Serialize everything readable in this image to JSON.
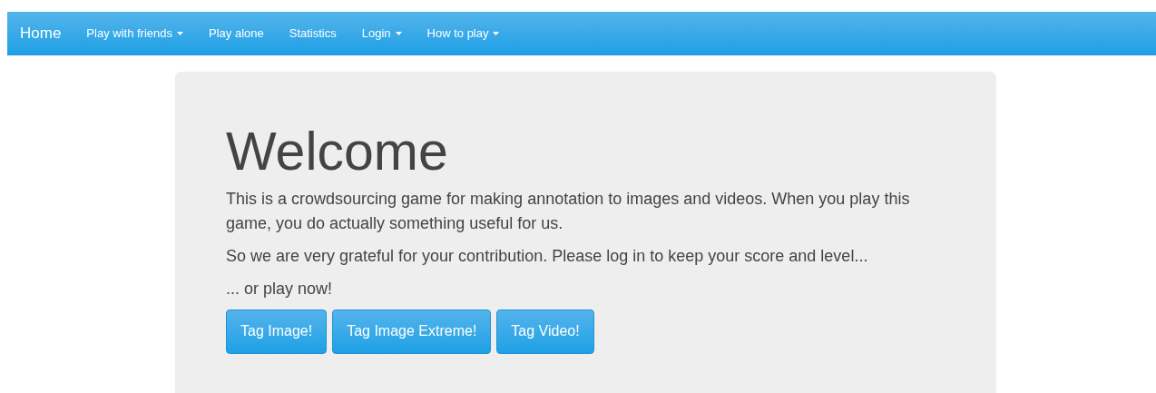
{
  "navbar": {
    "brand": "Home",
    "items": [
      {
        "label": "Play with friends",
        "has_menu": true
      },
      {
        "label": "Play alone",
        "has_menu": false
      },
      {
        "label": "Statistics",
        "has_menu": false
      },
      {
        "label": "Login",
        "has_menu": true
      },
      {
        "label": "How to play",
        "has_menu": true
      }
    ]
  },
  "jumbotron": {
    "heading": "Welcome",
    "paragraphs": [
      "This is a crowdsourcing game for making annotation to images and videos. When you play this game, you do actually something useful for us.",
      "So we are very grateful for your contribution. Please log in to keep your score and level...",
      "... or play now!"
    ],
    "buttons": [
      "Tag Image!",
      "Tag Image Extreme!",
      "Tag Video!"
    ]
  }
}
